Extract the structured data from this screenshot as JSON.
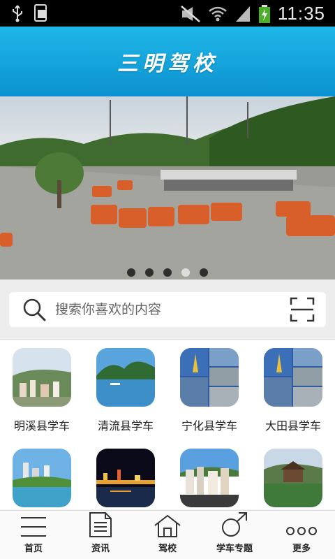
{
  "status_bar": {
    "time": "11:35",
    "icons": [
      "usb-icon",
      "phone-icon",
      "mute-icon",
      "wifi-icon",
      "signal-icon",
      "battery-charging-icon"
    ]
  },
  "header": {
    "title": "三明驾校"
  },
  "banner": {
    "slide_count": 5,
    "active_slide": 4
  },
  "search": {
    "placeholder": "搜索你喜欢的内容",
    "value": ""
  },
  "grid": {
    "items": [
      {
        "label": "明溪县学车"
      },
      {
        "label": "清流县学车"
      },
      {
        "label": "宁化县学车"
      },
      {
        "label": "大田县学车"
      },
      {
        "label": ""
      },
      {
        "label": ""
      },
      {
        "label": ""
      },
      {
        "label": ""
      }
    ]
  },
  "bottom_nav": {
    "items": [
      {
        "label": "首页",
        "icon": "menu-icon"
      },
      {
        "label": "资讯",
        "icon": "document-icon"
      },
      {
        "label": "驾校",
        "icon": "home-icon"
      },
      {
        "label": "学车专题",
        "icon": "male-symbol-icon"
      },
      {
        "label": "更多",
        "icon": "more-dots-icon"
      }
    ]
  }
}
